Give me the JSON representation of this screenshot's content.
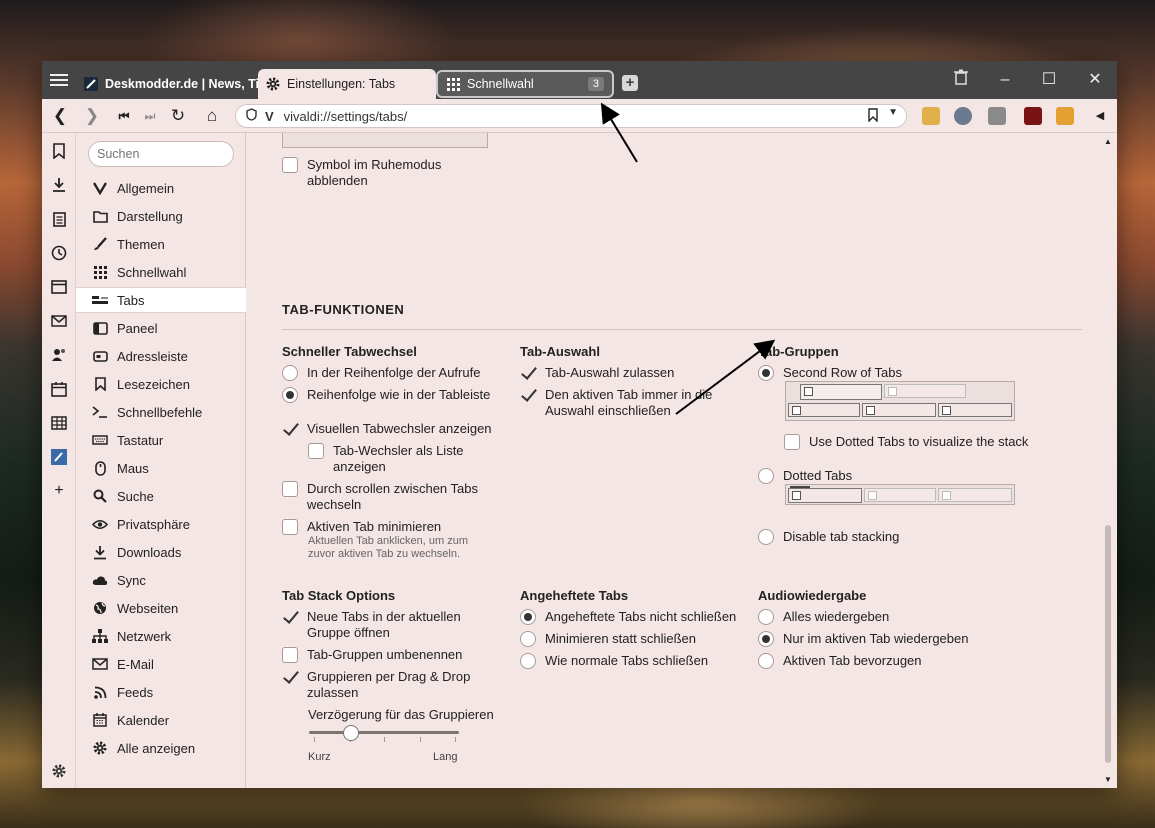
{
  "tabs": [
    {
      "label": "Deskmodder.de | News, Tip",
      "icon": "pen-icon"
    },
    {
      "label": "Einstellungen: Tabs",
      "icon": "gear-icon"
    },
    {
      "label": "Schnellwahl",
      "icon": "grid-icon",
      "count": "3"
    }
  ],
  "address": {
    "url": "vivaldi://settings/tabs/"
  },
  "search": {
    "placeholder": "Suchen"
  },
  "sidebar": {
    "items": [
      {
        "label": "Allgemein",
        "icon": "vivaldi-icon"
      },
      {
        "label": "Darstellung",
        "icon": "folder-icon"
      },
      {
        "label": "Themen",
        "icon": "brush-icon"
      },
      {
        "label": "Schnellwahl",
        "icon": "grid-icon"
      },
      {
        "label": "Tabs",
        "icon": "tabs-icon",
        "active": true
      },
      {
        "label": "Paneel",
        "icon": "panel-icon"
      },
      {
        "label": "Adressleiste",
        "icon": "address-bar-icon"
      },
      {
        "label": "Lesezeichen",
        "icon": "bookmark-icon"
      },
      {
        "label": "Schnellbefehle",
        "icon": "command-icon"
      },
      {
        "label": "Tastatur",
        "icon": "keyboard-icon"
      },
      {
        "label": "Maus",
        "icon": "mouse-icon"
      },
      {
        "label": "Suche",
        "icon": "search-icon"
      },
      {
        "label": "Privatsphäre",
        "icon": "eye-icon"
      },
      {
        "label": "Downloads",
        "icon": "download-icon"
      },
      {
        "label": "Sync",
        "icon": "cloud-icon"
      },
      {
        "label": "Webseiten",
        "icon": "globe-icon"
      },
      {
        "label": "Netzwerk",
        "icon": "network-icon"
      },
      {
        "label": "E-Mail",
        "icon": "mail-icon"
      },
      {
        "label": "Feeds",
        "icon": "rss-icon"
      },
      {
        "label": "Kalender",
        "icon": "calendar-icon"
      },
      {
        "label": "Alle anzeigen",
        "icon": "gear-icon"
      }
    ]
  },
  "settings": {
    "hibernate_icon": {
      "label": "Symbol im Ruhemodus abblenden",
      "checked": false
    },
    "section_title": "TAB-FUNKTIONEN",
    "fast_switch": {
      "title": "Schneller Tabwechsel",
      "opt1": "In der Reihenfolge der Aufrufe",
      "opt2": "Reihenfolge wie in der Tableiste",
      "visual": "Visuellen Tabwechsler anzeigen",
      "as_list": "Tab-Wechsler als Liste anzeigen",
      "scroll": "Durch scrollen zwischen Tabs wechseln",
      "minimize": "Aktiven Tab minimieren",
      "minimize_hint": "Aktuellen Tab anklicken, um zum zuvor aktiven Tab zu wechseln."
    },
    "tab_select": {
      "title": "Tab-Auswahl",
      "allow": "Tab-Auswahl zulassen",
      "include_active": "Den aktiven Tab immer in die Auswahl einschließen"
    },
    "tab_groups": {
      "title": "Tab-Gruppen",
      "second_row": "Second Row of Tabs",
      "dotted_visual": "Use Dotted Tabs to visualize the stack",
      "dotted": "Dotted Tabs",
      "disable": "Disable tab stacking"
    },
    "stack_options": {
      "title": "Tab Stack Options",
      "open_in_group": "Neue Tabs in der aktuellen Gruppe öffnen",
      "rename": "Tab-Gruppen umbenennen",
      "drag_drop": "Gruppieren per Drag & Drop zulassen",
      "delay_label": "Verzögerung für das Gruppieren",
      "delay_min": "Kurz",
      "delay_max": "Lang",
      "delay_value": 0.28
    },
    "pinned": {
      "title": "Angeheftete Tabs",
      "opt1": "Angeheftete Tabs nicht schließen",
      "opt2": "Minimieren statt schließen",
      "opt3": "Wie normale Tabs schließen"
    },
    "audio": {
      "title": "Audiowiedergabe",
      "opt1": "Alles wiedergeben",
      "opt2": "Nur im aktiven Tab wiedergeben",
      "opt3": "Aktiven Tab bevorzugen"
    }
  }
}
